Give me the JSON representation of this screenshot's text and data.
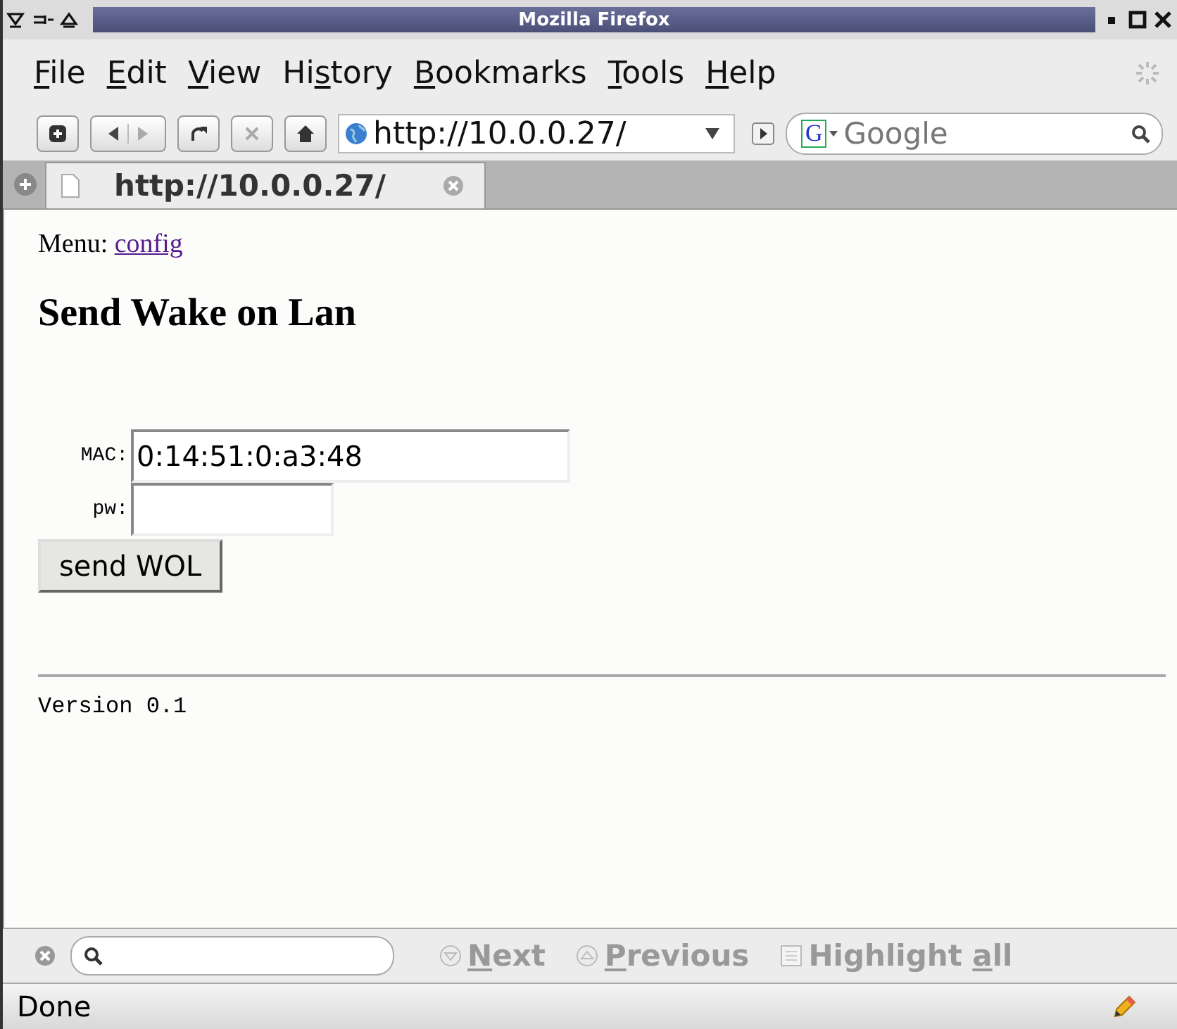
{
  "window": {
    "title": "Mozilla Firefox"
  },
  "menu": [
    {
      "key": "F",
      "after": "ile"
    },
    {
      "key": "E",
      "after": "dit"
    },
    {
      "key": "V",
      "after": "iew"
    },
    {
      "before": "Hi",
      "key": "s",
      "after": "tory"
    },
    {
      "key": "B",
      "after": "ookmarks"
    },
    {
      "key": "T",
      "after": "ools"
    },
    {
      "key": "H",
      "after": "elp"
    }
  ],
  "toolbar": {
    "url": "http://10.0.0.27/",
    "search": {
      "engine_logo": "G",
      "placeholder": "Google"
    }
  },
  "tabs": [
    {
      "label": "http://10.0.0.27/",
      "selected": true
    }
  ],
  "page": {
    "menu_label": "Menu:",
    "menu_link": "config",
    "heading": "Send Wake on Lan",
    "fields": [
      {
        "label": "MAC:",
        "value": "0:14:51:0:a3:48",
        "kind": "wide"
      },
      {
        "label": "pw:",
        "kind": "narrow"
      }
    ],
    "button": "send WOL",
    "version": "Version 0.1"
  },
  "find_bar": {
    "buttons": [
      {
        "key": "N",
        "after": "ext",
        "kind": "down"
      },
      {
        "key": "P",
        "after": "revious",
        "kind": "up"
      },
      {
        "before": "Highlight ",
        "key": "a",
        "after": "ll",
        "kind": "check"
      }
    ]
  },
  "status_bar": {
    "text": "Done"
  }
}
